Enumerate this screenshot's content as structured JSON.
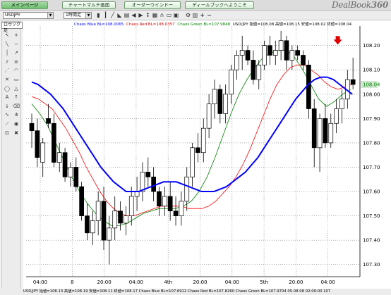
{
  "tabs": [
    {
      "label": "メインページ",
      "active": true
    },
    {
      "label": "チャートマルチ画面",
      "active": false
    },
    {
      "label": "オーダーウインドー",
      "active": false
    },
    {
      "label": "ディールブックへようこそ",
      "active": false
    }
  ],
  "brand": {
    "name": "DealBook",
    "version": "360"
  },
  "toolbar": {
    "symbol": "USDJPY",
    "timeframe": "1時間足"
  },
  "row2": {
    "chart_type": "ロウソク足"
  },
  "legend": {
    "blue": "Chaos Blue BL=108.0065",
    "red": "Chaos Red BL=108.0357",
    "green": "Chaos Green BL=107.9848",
    "ohlc": "USD/JPY 始値=108.08 高値=108.15 安値=108.02 終値=108.04",
    "colors": {
      "blue": "#0000ff",
      "red": "#ff0000",
      "green": "#008000"
    }
  },
  "status": {
    "text": "USD/JPY 始値=108.13 高値=108.19 安値=108.11 終値=108.17  Chaos Blue BL=107.6912  Chaos Red BL=107.8260  Chaos Green BL=107.9704  05.08.08 02:00:00 107"
  },
  "chart_data": {
    "type": "candlestick",
    "y_ticks": [
      "108.20",
      "108.10",
      "108.00",
      "107.90",
      "107.80",
      "107.70",
      "107.60",
      "107.50",
      "107.40",
      "107.30"
    ],
    "ylim": [
      107.25,
      108.28
    ],
    "x_ticks": [
      "04:00",
      "8",
      "20:00",
      "04:00",
      "4th",
      "20:00",
      "04:00",
      "5th",
      "20:00",
      "04:00"
    ],
    "current_price_label": "108.04",
    "current_price": 108.04,
    "candles": [
      {
        "o": 107.88,
        "h": 107.92,
        "l": 107.78,
        "c": 107.85
      },
      {
        "o": 107.85,
        "h": 107.9,
        "l": 107.7,
        "c": 107.74
      },
      {
        "o": 107.72,
        "h": 107.82,
        "l": 107.66,
        "c": 107.8
      },
      {
        "o": 107.9,
        "h": 107.96,
        "l": 107.86,
        "c": 107.88
      },
      {
        "o": 107.88,
        "h": 107.92,
        "l": 107.7,
        "c": 107.72
      },
      {
        "o": 107.72,
        "h": 107.8,
        "l": 107.68,
        "c": 107.76
      },
      {
        "o": 107.76,
        "h": 107.78,
        "l": 107.64,
        "c": 107.66
      },
      {
        "o": 107.66,
        "h": 107.72,
        "l": 107.62,
        "c": 107.7
      },
      {
        "o": 107.7,
        "h": 107.74,
        "l": 107.6,
        "c": 107.62
      },
      {
        "o": 107.62,
        "h": 107.64,
        "l": 107.48,
        "c": 107.5
      },
      {
        "o": 107.5,
        "h": 107.55,
        "l": 107.4,
        "c": 107.43
      },
      {
        "o": 107.43,
        "h": 107.52,
        "l": 107.38,
        "c": 107.48
      },
      {
        "o": 107.48,
        "h": 107.6,
        "l": 107.42,
        "c": 107.56
      },
      {
        "o": 107.56,
        "h": 107.62,
        "l": 107.36,
        "c": 107.4
      },
      {
        "o": 107.4,
        "h": 107.5,
        "l": 107.3,
        "c": 107.45
      },
      {
        "o": 107.45,
        "h": 107.58,
        "l": 107.4,
        "c": 107.52
      },
      {
        "o": 107.52,
        "h": 107.56,
        "l": 107.44,
        "c": 107.47
      },
      {
        "o": 107.47,
        "h": 107.54,
        "l": 107.42,
        "c": 107.5
      },
      {
        "o": 107.5,
        "h": 107.62,
        "l": 107.46,
        "c": 107.58
      },
      {
        "o": 107.58,
        "h": 107.66,
        "l": 107.52,
        "c": 107.6
      },
      {
        "o": 107.6,
        "h": 107.72,
        "l": 107.56,
        "c": 107.68
      },
      {
        "o": 107.68,
        "h": 107.74,
        "l": 107.62,
        "c": 107.66
      },
      {
        "o": 107.66,
        "h": 107.7,
        "l": 107.56,
        "c": 107.6
      },
      {
        "o": 107.6,
        "h": 107.62,
        "l": 107.5,
        "c": 107.54
      },
      {
        "o": 107.54,
        "h": 107.62,
        "l": 107.5,
        "c": 107.58
      },
      {
        "o": 107.58,
        "h": 107.64,
        "l": 107.48,
        "c": 107.52
      },
      {
        "o": 107.52,
        "h": 107.58,
        "l": 107.46,
        "c": 107.5
      },
      {
        "o": 107.5,
        "h": 107.6,
        "l": 107.46,
        "c": 107.56
      },
      {
        "o": 107.56,
        "h": 107.7,
        "l": 107.52,
        "c": 107.66
      },
      {
        "o": 107.66,
        "h": 107.8,
        "l": 107.62,
        "c": 107.78
      },
      {
        "o": 107.78,
        "h": 107.84,
        "l": 107.72,
        "c": 107.76
      },
      {
        "o": 107.76,
        "h": 107.9,
        "l": 107.72,
        "c": 107.86
      },
      {
        "o": 107.86,
        "h": 108.0,
        "l": 107.82,
        "c": 107.96
      },
      {
        "o": 107.96,
        "h": 108.06,
        "l": 107.9,
        "c": 108.02
      },
      {
        "o": 108.02,
        "h": 108.04,
        "l": 107.88,
        "c": 107.92
      },
      {
        "o": 107.92,
        "h": 108.04,
        "l": 107.88,
        "c": 108.0
      },
      {
        "o": 108.0,
        "h": 108.12,
        "l": 107.96,
        "c": 108.1
      },
      {
        "o": 108.1,
        "h": 108.18,
        "l": 108.06,
        "c": 108.16
      },
      {
        "o": 108.16,
        "h": 108.24,
        "l": 108.1,
        "c": 108.18
      },
      {
        "o": 108.18,
        "h": 108.2,
        "l": 108.12,
        "c": 108.14
      },
      {
        "o": 108.14,
        "h": 108.18,
        "l": 108.04,
        "c": 108.06
      },
      {
        "o": 108.06,
        "h": 108.14,
        "l": 108.02,
        "c": 108.12
      },
      {
        "o": 108.12,
        "h": 108.22,
        "l": 108.1,
        "c": 108.2
      },
      {
        "o": 108.2,
        "h": 108.24,
        "l": 108.12,
        "c": 108.16
      },
      {
        "o": 108.16,
        "h": 108.22,
        "l": 108.12,
        "c": 108.18
      },
      {
        "o": 108.18,
        "h": 108.26,
        "l": 108.14,
        "c": 108.22
      },
      {
        "o": 108.22,
        "h": 108.24,
        "l": 108.1,
        "c": 108.14
      },
      {
        "o": 108.14,
        "h": 108.2,
        "l": 108.1,
        "c": 108.18
      },
      {
        "o": 108.18,
        "h": 108.2,
        "l": 108.14,
        "c": 108.16
      },
      {
        "o": 108.16,
        "h": 108.18,
        "l": 108.1,
        "c": 108.12
      },
      {
        "o": 108.12,
        "h": 108.14,
        "l": 107.9,
        "c": 107.94
      },
      {
        "o": 107.94,
        "h": 107.98,
        "l": 107.7,
        "c": 107.78
      },
      {
        "o": 107.78,
        "h": 107.92,
        "l": 107.68,
        "c": 107.9
      },
      {
        "o": 107.9,
        "h": 107.96,
        "l": 107.78,
        "c": 107.8
      },
      {
        "o": 107.8,
        "h": 107.92,
        "l": 107.78,
        "c": 107.88
      },
      {
        "o": 107.88,
        "h": 107.98,
        "l": 107.84,
        "c": 107.94
      },
      {
        "o": 107.94,
        "h": 108.02,
        "l": 107.88,
        "c": 107.98
      },
      {
        "o": 107.98,
        "h": 108.1,
        "l": 107.94,
        "c": 108.06
      },
      {
        "o": 108.06,
        "h": 108.15,
        "l": 108.02,
        "c": 108.04
      }
    ],
    "chaos_blue": [
      108.05,
      108.04,
      108.02,
      108.0,
      107.97,
      107.94,
      107.9,
      107.86,
      107.82,
      107.78,
      107.74,
      107.7,
      107.67,
      107.64,
      107.62,
      107.6,
      107.6,
      107.6,
      107.61,
      107.62,
      107.63,
      107.64,
      107.64,
      107.64,
      107.63,
      107.62,
      107.61,
      107.6,
      107.6,
      107.6,
      107.61,
      107.62,
      107.64,
      107.66,
      107.68,
      107.71,
      107.74,
      107.78,
      107.82,
      107.86,
      107.9,
      107.94,
      107.98,
      108.01,
      108.04,
      108.06,
      108.07,
      108.07,
      108.06,
      108.04,
      108.02,
      108.0
    ],
    "chaos_red": [
      107.99,
      107.98,
      107.96,
      107.94,
      107.9,
      107.86,
      107.81,
      107.76,
      107.7,
      107.65,
      107.6,
      107.56,
      107.53,
      107.51,
      107.5,
      107.5,
      107.51,
      107.52,
      107.53,
      107.54,
      107.54,
      107.54,
      107.54,
      107.53,
      107.53,
      107.53,
      107.54,
      107.56,
      107.59,
      107.62,
      107.66,
      107.71,
      107.77,
      107.84,
      107.91,
      107.98,
      108.04,
      108.08,
      108.11,
      108.12,
      108.12,
      108.1,
      108.08,
      108.05,
      108.03,
      108.02,
      108.03,
      108.04
    ],
    "chaos_green": [
      107.96,
      107.92,
      107.87,
      107.8,
      107.73,
      107.66,
      107.6,
      107.55,
      107.51,
      107.48,
      107.46,
      107.46,
      107.47,
      107.49,
      107.51,
      107.52,
      107.53,
      107.53,
      107.53,
      107.54,
      107.56,
      107.6,
      107.66,
      107.74,
      107.83,
      107.92,
      108.0,
      108.06,
      108.11,
      108.15,
      108.17,
      108.18,
      108.18,
      108.15,
      108.1,
      108.04,
      107.98,
      107.95,
      107.97,
      108.0,
      108.02
    ]
  }
}
